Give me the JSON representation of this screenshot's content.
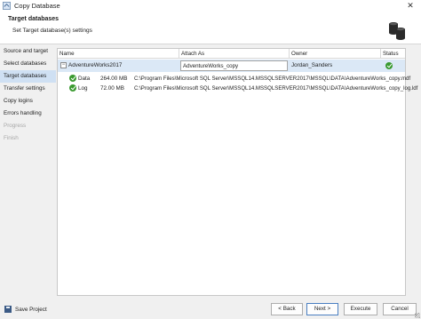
{
  "window": {
    "title": "Copy Database",
    "close_glyph": "✕"
  },
  "header": {
    "title": "Target databases",
    "subtitle": "Set Target database(s) settings",
    "icon": "database-stack-icon"
  },
  "sidebar": {
    "items": [
      {
        "label": "Source and target",
        "state": "normal"
      },
      {
        "label": "Select databases",
        "state": "normal"
      },
      {
        "label": "Target databases",
        "state": "active"
      },
      {
        "label": "Transfer settings",
        "state": "normal"
      },
      {
        "label": "Copy logins",
        "state": "normal"
      },
      {
        "label": "Errors handling",
        "state": "normal"
      },
      {
        "label": "Progress",
        "state": "disabled"
      },
      {
        "label": "Finish",
        "state": "disabled"
      }
    ]
  },
  "grid": {
    "columns": {
      "name": "Name",
      "attach_as": "Attach As",
      "owner": "Owner",
      "status": "Status"
    },
    "database": {
      "expander": "−",
      "name": "AdventureWorks2017",
      "attach_as": "AdventureWorks_copy",
      "owner": "Jordan_Sanders",
      "status": "ok"
    },
    "files": [
      {
        "type": "Data",
        "size": "264.00 MB",
        "path": "C:\\Program Files\\Microsoft SQL Server\\MSSQL14.MSSQLSERVER2017\\MSSQL\\DATA\\AdventureWorks_copy.mdf"
      },
      {
        "type": "Log",
        "size": "72.00 MB",
        "path": "C:\\Program Files\\Microsoft SQL Server\\MSSQL14.MSSQLSERVER2017\\MSSQL\\DATA\\AdventureWorks_copy_log.ldf"
      }
    ]
  },
  "footer": {
    "save_project": "Save Project",
    "back": "< Back",
    "next": "Next >",
    "execute": "Execute",
    "cancel": "Cancel"
  },
  "colors": {
    "accent": "#cfe0f3",
    "selected_row": "#dbe8f6",
    "ok_green": "#3a9a2f"
  }
}
